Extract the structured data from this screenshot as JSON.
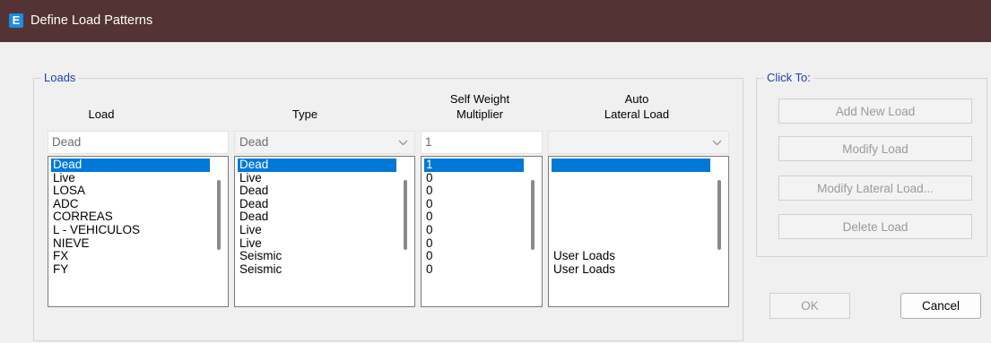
{
  "window": {
    "title": "Define Load Patterns",
    "app_icon_letter": "E"
  },
  "loads_group": {
    "legend": "Loads",
    "headers": {
      "load": "Load",
      "type": "Type",
      "self_weight_line1": "Self Weight",
      "self_weight_line2": "Multiplier",
      "auto_line1": "Auto",
      "auto_line2": "Lateral Load"
    },
    "inputs": {
      "load_value": "Dead",
      "type_value": "Dead",
      "multiplier_value": "1",
      "auto_value": ""
    },
    "lists": {
      "load": [
        "Dead",
        "Live",
        "LOSA",
        "ADC",
        "CORREAS",
        "L - VEHICULOS",
        "NIEVE",
        "FX",
        "FY"
      ],
      "type": [
        "Dead",
        "Live",
        "Dead",
        "Dead",
        "Dead",
        "Live",
        "Live",
        "Seismic",
        "Seismic"
      ],
      "multiplier": [
        "1",
        "0",
        "0",
        "0",
        "0",
        "0",
        "0",
        "0",
        "0"
      ],
      "auto": [
        "",
        "",
        "",
        "",
        "",
        "",
        "",
        "User Loads",
        "User Loads"
      ]
    }
  },
  "click_to_group": {
    "legend": "Click To:",
    "buttons": {
      "add_new_load": "Add New Load",
      "modify_load": "Modify Load",
      "modify_lateral_load": "Modify Lateral Load...",
      "delete_load": "Delete Load"
    }
  },
  "footer": {
    "ok_label": "OK",
    "cancel_label": "Cancel"
  },
  "icons": {
    "app": "etabs-app-icon",
    "dropdown": "chevron-down-icon"
  },
  "colors": {
    "titlebar": "#533333",
    "selection": "#0078d7",
    "legend_text": "#1f3fa8"
  }
}
